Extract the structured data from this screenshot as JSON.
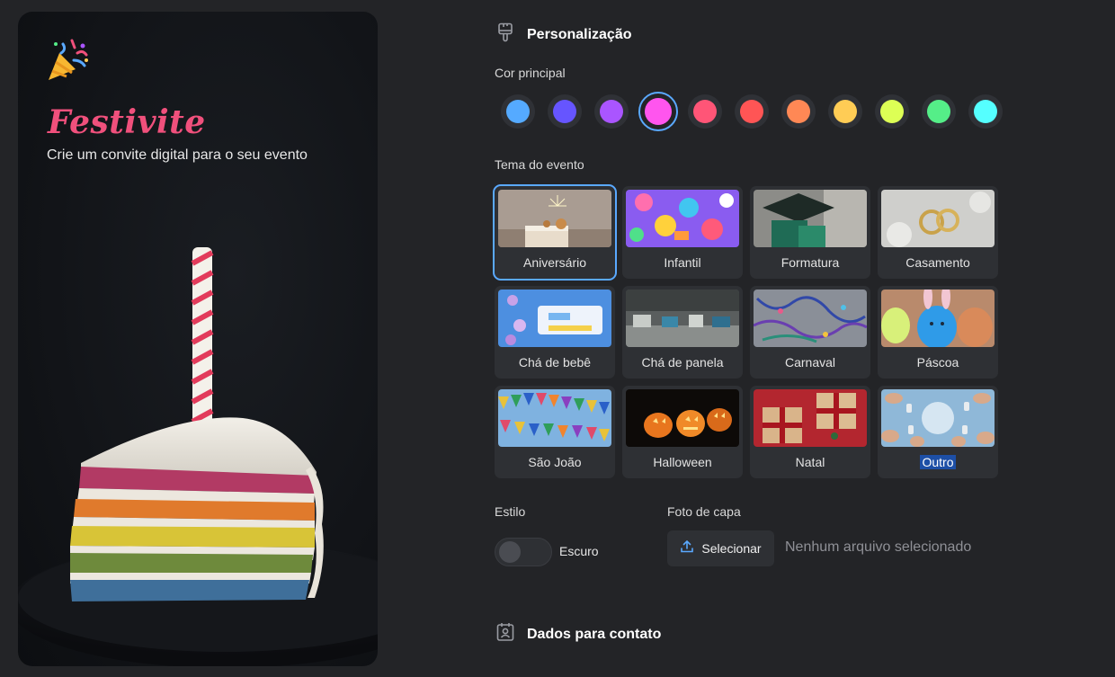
{
  "hero": {
    "title": "Festivite",
    "subtitle": "Crie um convite digital para o seu evento"
  },
  "customization": {
    "heading": "Personalização",
    "heading_icon": "paintbrush-icon",
    "color_label": "Cor principal",
    "colors": [
      {
        "name": "azul",
        "hex": "#55aaff"
      },
      {
        "name": "indigo",
        "hex": "#6655ff"
      },
      {
        "name": "roxo",
        "hex": "#aa55ff"
      },
      {
        "name": "rosa",
        "hex": "#ff55ee",
        "selected": true
      },
      {
        "name": "pink",
        "hex": "#ff5577"
      },
      {
        "name": "vermelho",
        "hex": "#ff5555"
      },
      {
        "name": "laranja",
        "hex": "#ff8855"
      },
      {
        "name": "amarelo",
        "hex": "#ffcc55"
      },
      {
        "name": "lima",
        "hex": "#ddff55"
      },
      {
        "name": "verde",
        "hex": "#55ee88"
      },
      {
        "name": "ciano",
        "hex": "#55ffff"
      }
    ],
    "theme_label": "Tema do evento",
    "themes": [
      {
        "label": "Aniversário",
        "selected": true
      },
      {
        "label": "Infantil"
      },
      {
        "label": "Formatura"
      },
      {
        "label": "Casamento"
      },
      {
        "label": "Chá de bebê"
      },
      {
        "label": "Chá de panela"
      },
      {
        "label": "Carnaval"
      },
      {
        "label": "Páscoa"
      },
      {
        "label": "São João"
      },
      {
        "label": "Halloween"
      },
      {
        "label": "Natal"
      },
      {
        "label": "Outro",
        "highlighted": true
      }
    ],
    "style_label": "Estilo",
    "style_toggle_label": "Escuro",
    "style_dark": false,
    "cover_label": "Foto de capa",
    "upload_button": "Selecionar",
    "upload_status": "Nenhum arquivo selecionado"
  },
  "contact": {
    "heading": "Dados para contato",
    "heading_icon": "contact-card-icon"
  },
  "colors": {
    "accent": "#5aa9ff",
    "brand": "#f0507c",
    "background": "#232427",
    "card": "#2e3034"
  }
}
